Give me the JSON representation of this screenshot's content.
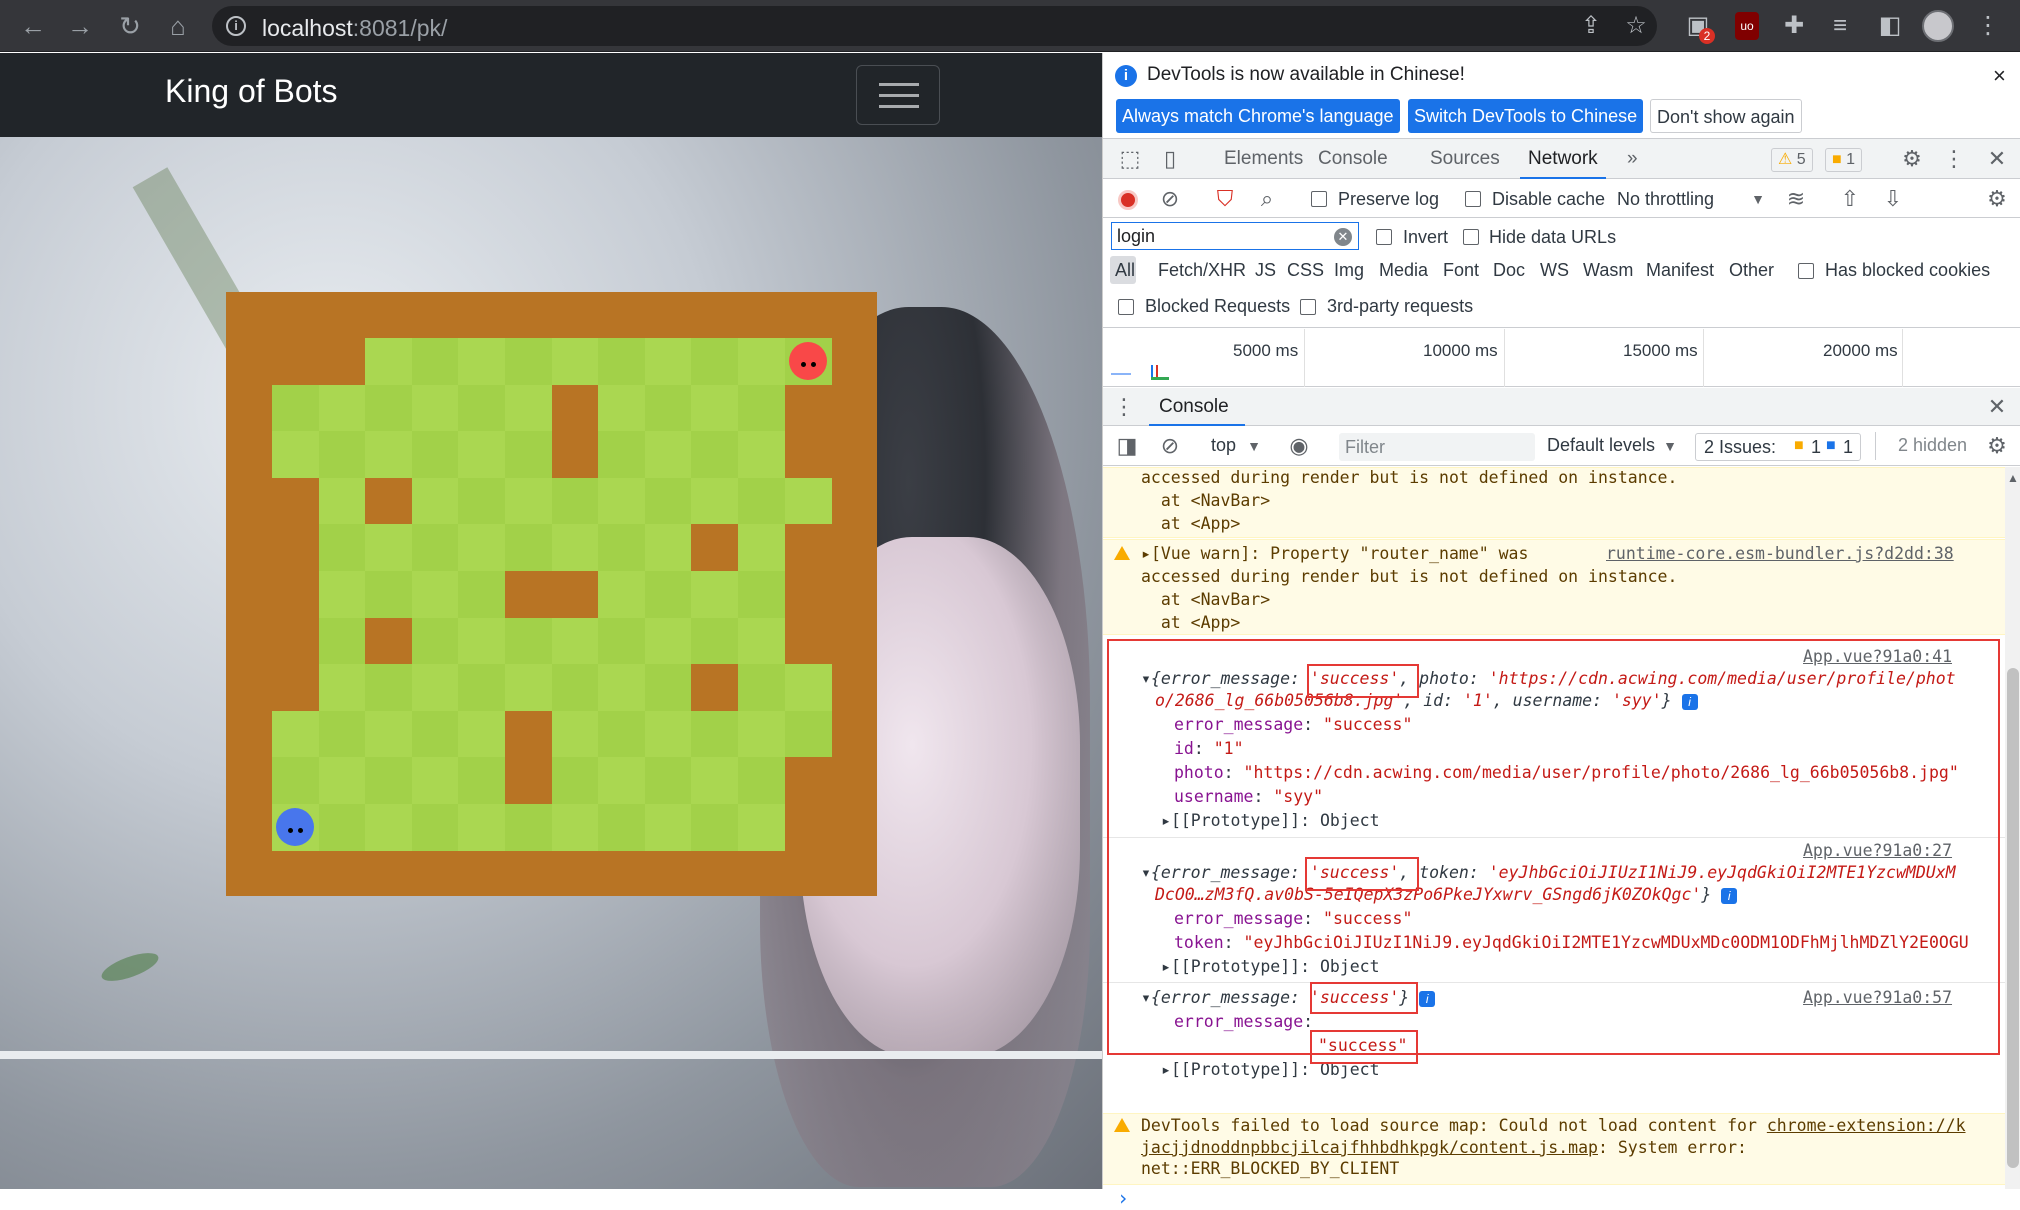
{
  "browser": {
    "url_host": "localhost",
    "url_rest": ":8081/pk/",
    "ext_badge": "2"
  },
  "app": {
    "brand": "King of Bots"
  },
  "game": {
    "rows": 13,
    "cols": 14,
    "colors": {
      "wall": "#b87424",
      "light": "#aad751",
      "dark": "#a2d149",
      "snake_a": "#f94848",
      "snake_b": "#4876ec"
    }
  },
  "devtools": {
    "infobar": {
      "message": "DevTools is now available in Chinese!",
      "btn_match": "Always match Chrome's language",
      "btn_switch": "Switch DevTools to Chinese",
      "btn_dismiss": "Don't show again",
      "close": "×"
    },
    "tabs": [
      "Elements",
      "Console",
      "Sources",
      "Network",
      "»"
    ],
    "active_tab": "Network",
    "warn_count": "5",
    "issue_count": "1",
    "network": {
      "preserve_log": "Preserve log",
      "disable_cache": "Disable cache",
      "throttling": "No throttling",
      "filter_value": "login",
      "invert": "Invert",
      "hide_data_urls": "Hide data URLs",
      "types": [
        "All",
        "Fetch/XHR",
        "JS",
        "CSS",
        "Img",
        "Media",
        "Font",
        "Doc",
        "WS",
        "Wasm",
        "Manifest",
        "Other"
      ],
      "has_blocked_cookies": "Has blocked cookies",
      "blocked_requests": "Blocked Requests",
      "third_party": "3rd-party requests",
      "timeline": [
        "5000 ms",
        "10000 ms",
        "15000 ms",
        "20000 ms"
      ]
    },
    "drawer_title": "Console",
    "console_toolbar": {
      "context": "top",
      "filter_placeholder": "Filter",
      "levels": "Default levels",
      "issues_label": "2 Issues:",
      "issues_warn": "1",
      "issues_info": "1",
      "hidden": "2 hidden"
    },
    "log": {
      "w1_l1": "accessed during render but is not defined on instance.",
      "w1_l2": "  at <NavBar>",
      "w1_l3": "  at <App>",
      "w2_l1": "[Vue warn]: Property \"router_name\" was",
      "w2_src": "runtime-core.esm-bundler.js?d2dd:38",
      "w2_l2": "accessed during render but is not defined on instance.",
      "w2_l3": "  at <NavBar>",
      "w2_l4": "  at <App>",
      "o1_src": "App.vue?91a0:41",
      "o1_l1a": "{error_message: ",
      "o1_l1b": "'success'",
      "o1_l1c": ", photo: ",
      "o1_l1d": "'https://cdn.acwing.com/media/user/profile/phot",
      "o1_l2a": "o/2686_lg_66b05056b8.jpg'",
      "o1_l2b": ", id: ",
      "o1_l2c": "'1'",
      "o1_l2d": ", username: ",
      "o1_l2e": "'syy'",
      "o1_l2f": "}",
      "o1_k1": "error_message",
      "o1_v1": "\"success\"",
      "o1_k2": "id",
      "o1_v2": "\"1\"",
      "o1_k3": "photo",
      "o1_v3": "\"https://cdn.acwing.com/media/user/profile/photo/2686_lg_66b05056b8.jpg\"",
      "o1_k4": "username",
      "o1_v4": "\"syy\"",
      "o1_proto": "[[Prototype]]: Object",
      "o2_src": "App.vue?91a0:27",
      "o2_l1a": "{error_message: ",
      "o2_l1b": "'success'",
      "o2_l1c": ", token: ",
      "o2_l1d": "'eyJhbGciOiJIUzI1NiJ9.eyJqdGkiOiI2MTE1YzcwMDUxM",
      "o2_l2a": "DcO0…zM3fQ.av0bS-5eIQepX3zPo6PkeJYxwrv_GSngd6jK0ZOkQgc'",
      "o2_l2b": "}",
      "o2_k1": "error_message",
      "o2_v1": "\"success\"",
      "o2_k2": "token",
      "o2_v2": "\"eyJhbGciOiJIUzI1NiJ9.eyJqdGkiOiI2MTE1YzcwMDUxMDc0ODM1ODFhMjlhMDZlY2E0OGU",
      "o2_proto": "[[Prototype]]: Object",
      "o3_src": "App.vue?91a0:57",
      "o3_l1a": "{error_message: ",
      "o3_l1b": "'success'",
      "o3_l1c": "}",
      "o3_k1": "error_message",
      "o3_v1": "\"success\"",
      "o3_proto": "[[Prototype]]: Object",
      "w3_l1a": "DevTools failed to load source map: Could not load content for ",
      "w3_l1b": "chrome-extension://k",
      "w3_l2a": "jacjjdnoddnpbbcjilcajfhhbdhkpgk/content.js.map",
      "w3_l2b": ": System error:",
      "w3_l3": "net::ERR_BLOCKED_BY_CLIENT",
      "prompt": "›"
    }
  }
}
